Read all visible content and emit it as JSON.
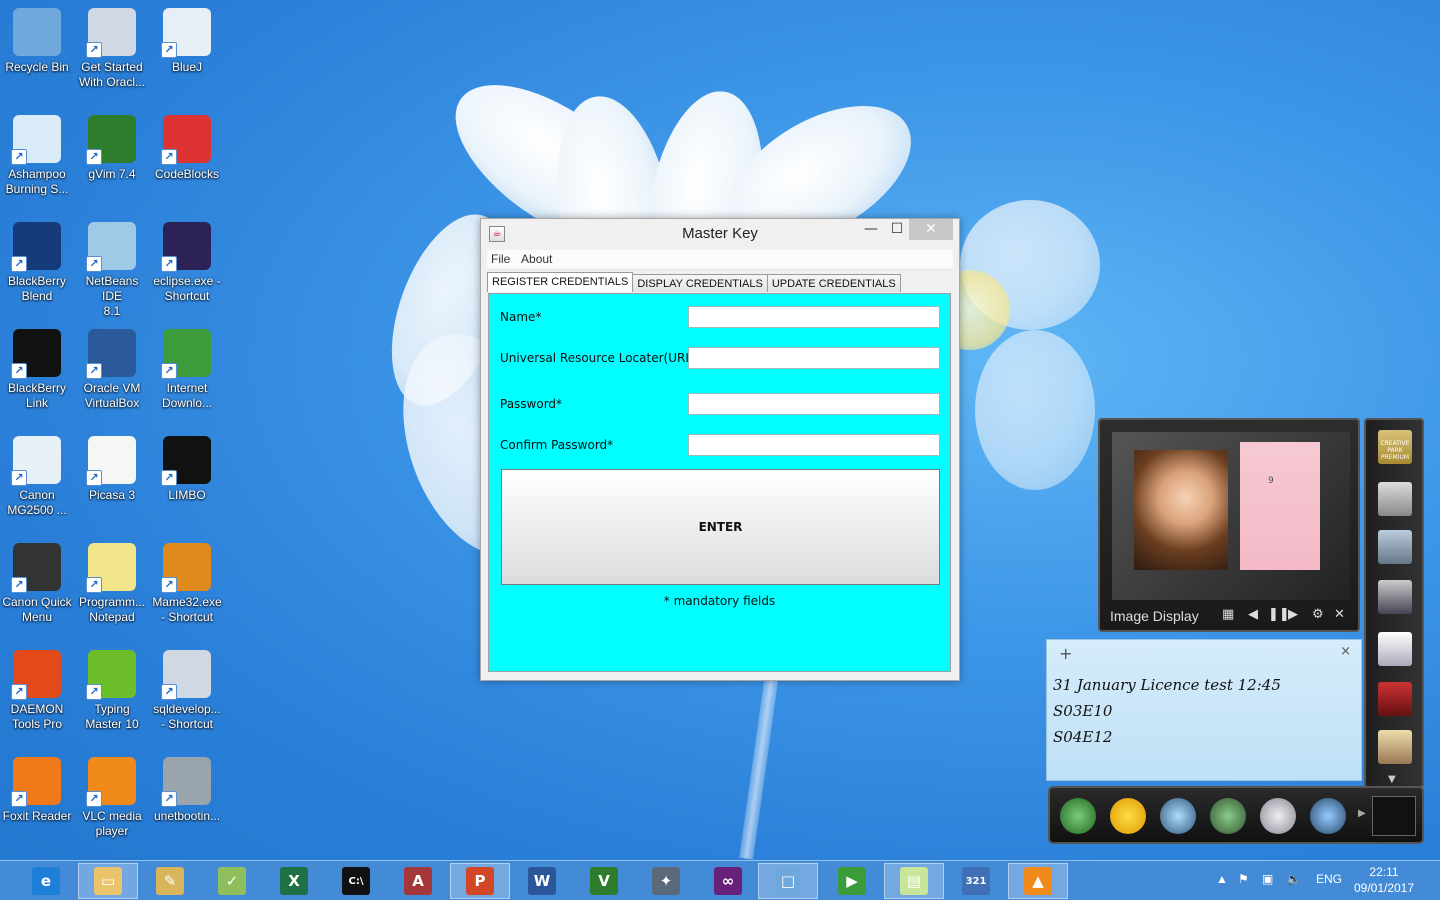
{
  "desktop": {
    "icons": [
      {
        "label": "Recycle Bin",
        "icon": "recycle-bin-icon",
        "color": "#6fa8dc"
      },
      {
        "label": "Get Started\nWith Oracl...",
        "icon": "oracle-xe-icon",
        "color": "#cfd8e3"
      },
      {
        "label": "BlueJ",
        "icon": "bluej-icon",
        "color": "#e8eef5"
      },
      {
        "label": "Ashampoo\nBurning S...",
        "icon": "ashampoo-icon",
        "color": "#d9ecf7"
      },
      {
        "label": "gVim 7.4",
        "icon": "gvim-icon",
        "color": "#2d7d2d"
      },
      {
        "label": "CodeBlocks",
        "icon": "codeblocks-icon",
        "color": "#d33"
      },
      {
        "label": "BlackBerry\nBlend",
        "icon": "blackberry-blend-icon",
        "color": "#163a7a"
      },
      {
        "label": "NetBeans IDE\n8.1",
        "icon": "netbeans-icon",
        "color": "#9ecae8"
      },
      {
        "label": "eclipse.exe -\nShortcut",
        "icon": "eclipse-icon",
        "color": "#2c2255"
      },
      {
        "label": "BlackBerry\nLink",
        "icon": "blackberry-link-icon",
        "color": "#111"
      },
      {
        "label": "Oracle VM\nVirtualBox",
        "icon": "virtualbox-icon",
        "color": "#2a5a9a"
      },
      {
        "label": "Internet\nDownlo...",
        "icon": "idm-icon",
        "color": "#3c9c3c"
      },
      {
        "label": "Canon\nMG2500 ...",
        "icon": "canon-printer-icon",
        "color": "#e8f0f8"
      },
      {
        "label": "Picasa 3",
        "icon": "picasa-icon",
        "color": "#f6f6f6"
      },
      {
        "label": "LIMBO",
        "icon": "limbo-icon",
        "color": "#111"
      },
      {
        "label": "Canon Quick\nMenu",
        "icon": "canon-quick-menu-icon",
        "color": "#333"
      },
      {
        "label": "Programm...\nNotepad",
        "icon": "programmers-notepad-icon",
        "color": "#f3e68a"
      },
      {
        "label": "Mame32.exe\n- Shortcut",
        "icon": "mame-icon",
        "color": "#e08a1e"
      },
      {
        "label": "DAEMON\nTools Pro",
        "icon": "daemon-tools-icon",
        "color": "#e24a1a"
      },
      {
        "label": "Typing\nMaster 10",
        "icon": "typing-master-icon",
        "color": "#6cbf2a"
      },
      {
        "label": "sqldevelop...\n- Shortcut",
        "icon": "sqldeveloper-icon",
        "color": "#cfd8e3"
      },
      {
        "label": "Foxit Reader",
        "icon": "foxit-reader-icon",
        "color": "#f07a1a"
      },
      {
        "label": "VLC media\nplayer",
        "icon": "vlc-icon",
        "color": "#f08a1a"
      },
      {
        "label": "unetbootin...",
        "icon": "unetbootin-icon",
        "color": "#9aa4ad"
      }
    ]
  },
  "window": {
    "title": "Master Key",
    "controls": {
      "minimize": "—",
      "maximize": "☐",
      "close": "✕"
    },
    "menu": [
      "File",
      "About"
    ],
    "tabs": [
      "REGISTER CREDENTIALS",
      "DISPLAY CREDENTIALS",
      "UPDATE CREDENTIALS"
    ],
    "form": {
      "name_label": "Name*",
      "url_label": "Universal Resource Locater(URL)",
      "password_label": "Password*",
      "confirm_label": "Confirm Password*",
      "name_value": "",
      "url_value": "",
      "password_value": "",
      "confirm_value": "",
      "enter_label": "ENTER",
      "mandatory_note": "* mandatory fields"
    },
    "panel_color": "#00ffff"
  },
  "gadget": {
    "caption": "Image Display",
    "calendar_day": "9"
  },
  "note": {
    "lines": [
      "31 January Licence test 12:45",
      "S03E10",
      "S04E12"
    ],
    "add": "+",
    "close": "×"
  },
  "sidebar": {
    "badge": "CREATIVE PARK PREMIUM"
  },
  "taskbar": {
    "apps": [
      {
        "icon": "internet-explorer-icon",
        "glyph": "e",
        "color": "#1e7fd9"
      },
      {
        "icon": "file-explorer-icon",
        "glyph": "▭",
        "color": "#e9c46a"
      },
      {
        "icon": "paint-icon",
        "glyph": "✎",
        "color": "#d8b55a"
      },
      {
        "icon": "notepad-plus-icon",
        "glyph": "✓",
        "color": "#8fbf5a"
      },
      {
        "icon": "excel-icon",
        "glyph": "X",
        "color": "#1e7145"
      },
      {
        "icon": "command-prompt-icon",
        "glyph": "C:\\",
        "color": "#111111"
      },
      {
        "icon": "access-icon",
        "glyph": "A",
        "color": "#a4373a"
      },
      {
        "icon": "powerpoint-icon",
        "glyph": "P",
        "color": "#d24726"
      },
      {
        "icon": "word-icon",
        "glyph": "W",
        "color": "#2b579a"
      },
      {
        "icon": "gvim-icon",
        "glyph": "V",
        "color": "#2d7d2d"
      },
      {
        "icon": "bluej-icon",
        "glyph": "✦",
        "color": "#5b6a7a"
      },
      {
        "icon": "visual-studio-icon",
        "glyph": "∞",
        "color": "#68217a"
      },
      {
        "icon": "virtualbox-icon",
        "glyph": "□",
        "color": "#6fa8dc"
      },
      {
        "icon": "media-center-icon",
        "glyph": "▶",
        "color": "#3c9c3c"
      },
      {
        "icon": "sticky-notes-icon",
        "glyph": "▤",
        "color": "#c9e59a"
      },
      {
        "icon": "media-player-classic-icon",
        "glyph": "321",
        "color": "#3f6fb5"
      },
      {
        "icon": "vlc-icon",
        "glyph": "▲",
        "color": "#f08a1a"
      }
    ],
    "tray": {
      "language": "ENG",
      "time": "22:11",
      "date": "09/01/2017"
    }
  }
}
